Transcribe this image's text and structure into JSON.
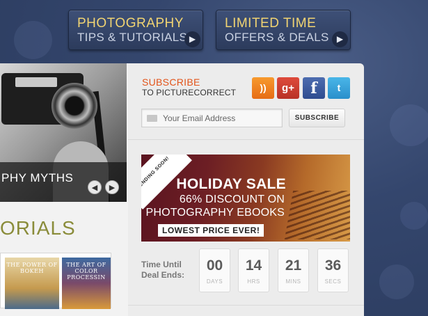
{
  "nav": {
    "photography": {
      "line1": "PHOTOGRAPHY",
      "line2": "TIPS & TUTORIALS"
    },
    "offers": {
      "line1": "LIMITED TIME",
      "line2": "OFFERS & DEALS"
    },
    "arrow_icon": "arrow-right-icon"
  },
  "feature": {
    "caption": "PHY MYTHS",
    "prev_glyph": "◀",
    "next_glyph": "▶"
  },
  "tutorials": {
    "heading": "ORIALS"
  },
  "books": [
    {
      "title": "THE POWER OF BOKEH"
    },
    {
      "title": "THE ART OF COLOR PROCESSIN"
    }
  ],
  "subscribe": {
    "title": "SUBSCRIBE",
    "subtitle": "TO PICTURECORRECT",
    "email_placeholder": "Your Email Address",
    "button_label": "SUBSCRIBE",
    "social": [
      {
        "name": "rss-icon",
        "glyph": "))"
      },
      {
        "name": "google-plus-icon",
        "glyph": "g+"
      },
      {
        "name": "facebook-icon",
        "glyph": "f"
      },
      {
        "name": "twitter-icon",
        "glyph": "t"
      }
    ]
  },
  "sale": {
    "ribbon": "ENDING SOON!",
    "headline": "HOLIDAY SALE",
    "line2": "66% DISCOUNT ON",
    "line3": "PHOTOGRAPHY EBOOKS",
    "badge": "LOWEST PRICE EVER!"
  },
  "countdown": {
    "label": "Time Until Deal Ends:",
    "days": {
      "value": "00",
      "unit": "DAYS"
    },
    "hrs": {
      "value": "14",
      "unit": "HRS"
    },
    "mins": {
      "value": "21",
      "unit": "MINS"
    },
    "secs": {
      "value": "36",
      "unit": "SECS"
    }
  },
  "colors": {
    "background": "#34466d",
    "nav_highlight": "#f1d472",
    "subscribe_accent": "#e2541a",
    "tutorials_green": "#8a8c3a",
    "sale_maroon": "#6c1e24"
  }
}
